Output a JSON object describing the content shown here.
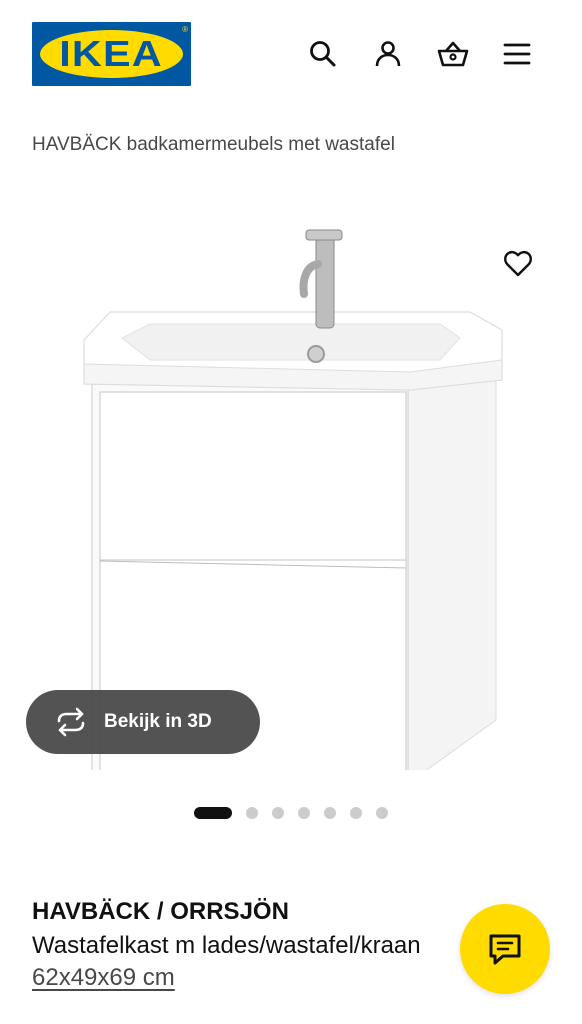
{
  "header": {
    "logo_text": "IKEA",
    "icons": [
      "search-icon",
      "user-icon",
      "basket-icon",
      "menu-icon"
    ]
  },
  "breadcrumb": "HAVBÄCK badkamermeubels met wastafel",
  "gallery": {
    "view_3d_label": "Bekijk in 3D",
    "image_count": 7,
    "active_index": 0
  },
  "product": {
    "name": "HAVBÄCK / ORRSJÖN",
    "description": "Wastafelkast m lades/wastafel/kraan",
    "size": "62x49x69 cm"
  },
  "colors": {
    "brand_blue": "#0058a3",
    "brand_yellow": "#ffdb00",
    "text_dark": "#111111",
    "text_muted": "#484848",
    "dot_inactive": "#cccccc"
  }
}
